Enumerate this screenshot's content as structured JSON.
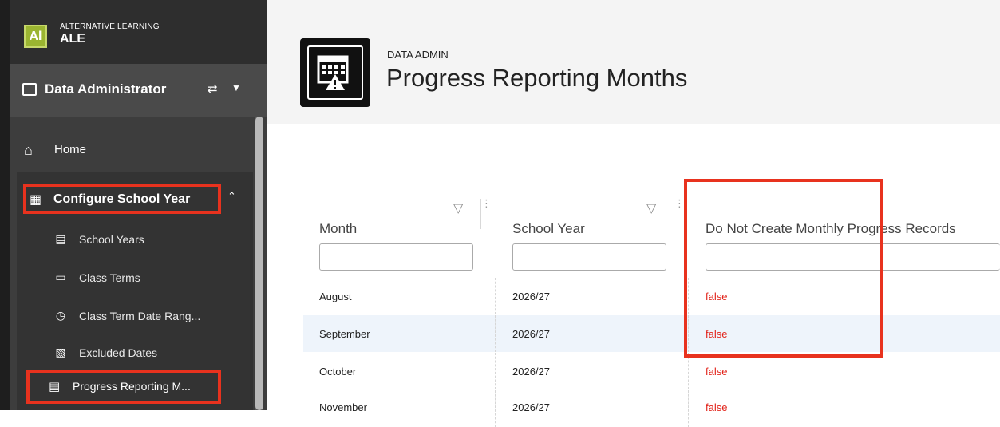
{
  "app": {
    "logo_text": "Al",
    "subtitle": "ALTERNATIVE LEARNING",
    "name": "ALE"
  },
  "role": {
    "label": "Data Administrator"
  },
  "nav": {
    "home": "Home",
    "group": {
      "label": "Configure School Year",
      "expanded": true
    },
    "items": [
      {
        "label": "School Years",
        "icon": "calendar-icon"
      },
      {
        "label": "Class Terms",
        "icon": "monitor-icon"
      },
      {
        "label": "Class Term Date Rang...",
        "icon": "calendar-clock-icon"
      },
      {
        "label": "Excluded Dates",
        "icon": "calendar-x-icon"
      },
      {
        "label": "Progress Reporting M...",
        "icon": "calendar-warning-icon",
        "active": true
      }
    ]
  },
  "page": {
    "kicker": "DATA ADMIN",
    "title": "Progress Reporting Months"
  },
  "grid": {
    "columns": [
      "Month",
      "School Year",
      "Do Not Create Monthly Progress Records"
    ],
    "rows": [
      {
        "month": "August",
        "year": "2026/27",
        "flag": "false"
      },
      {
        "month": "September",
        "year": "2026/27",
        "flag": "false"
      },
      {
        "month": "October",
        "year": "2026/27",
        "flag": "false"
      },
      {
        "month": "November",
        "year": "2026/27",
        "flag": "false"
      }
    ]
  },
  "colors": {
    "accent": "#9bb531",
    "highlight": "#e8321e",
    "false_text": "#e2231a",
    "sidebar": "#3d3d3d"
  }
}
